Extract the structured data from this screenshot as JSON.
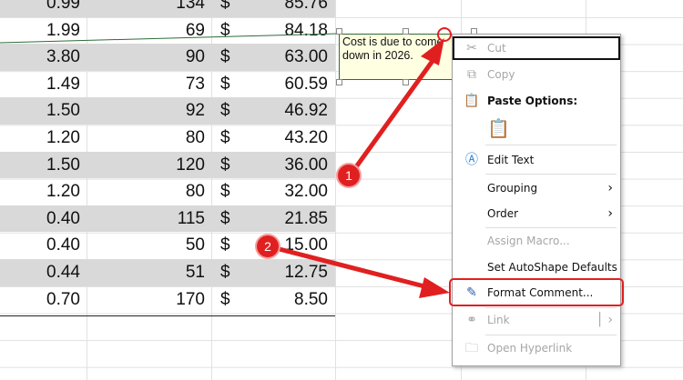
{
  "rows": [
    {
      "a": "0.99",
      "b": "134",
      "cur": "$",
      "c": "85.76"
    },
    {
      "a": "1.99",
      "b": "69",
      "cur": "$",
      "c": "84.18"
    },
    {
      "a": "3.80",
      "b": "90",
      "cur": "$",
      "c": "63.00"
    },
    {
      "a": "1.49",
      "b": "73",
      "cur": "$",
      "c": "60.59"
    },
    {
      "a": "1.50",
      "b": "92",
      "cur": "$",
      "c": "46.92"
    },
    {
      "a": "1.20",
      "b": "80",
      "cur": "$",
      "c": "43.20"
    },
    {
      "a": "1.50",
      "b": "120",
      "cur": "$",
      "c": "36.00"
    },
    {
      "a": "1.20",
      "b": "80",
      "cur": "$",
      "c": "32.00"
    },
    {
      "a": "0.40",
      "b": "115",
      "cur": "$",
      "c": "21.85"
    },
    {
      "a": "0.40",
      "b": "50",
      "cur": "$",
      "c": "15.00"
    },
    {
      "a": "0.44",
      "b": "51",
      "cur": "$",
      "c": "12.75"
    },
    {
      "a": "0.70",
      "b": "170",
      "cur": "$",
      "c": "8.50"
    }
  ],
  "comment": "Cost is due to come down in 2026.",
  "menu": {
    "cut": "Cut",
    "copy": "Copy",
    "paste_options": "Paste Options:",
    "edit_text": "Edit Text",
    "grouping": "Grouping",
    "order": "Order",
    "assign_macro": "Assign Macro...",
    "set_defaults": "Set AutoShape Defaults",
    "format_comment": "Format Comment...",
    "link": "Link",
    "open_hyperlink": "Open Hyperlink"
  },
  "badges": {
    "one": "1",
    "two": "2"
  },
  "colors": {
    "annotation": "#e02020",
    "shade": "#d9d9d9",
    "note": "#ffffe1"
  }
}
